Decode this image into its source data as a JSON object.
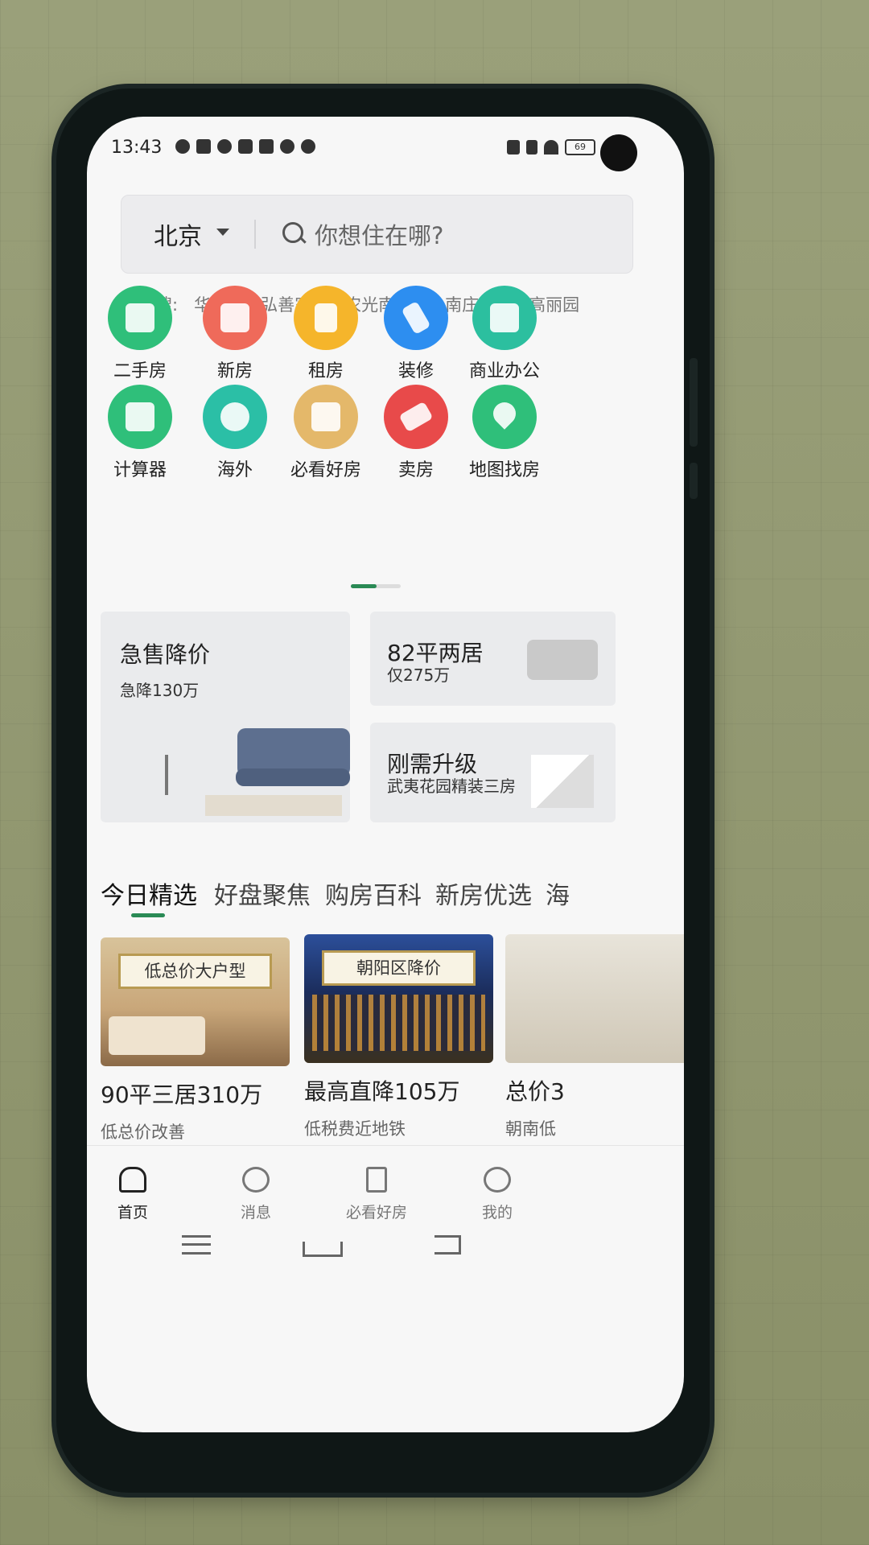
{
  "status_bar": {
    "time": "13:43",
    "battery": "69"
  },
  "search": {
    "city": "北京",
    "placeholder": "你想住在哪?"
  },
  "hot_search": {
    "label": "热搜:",
    "items": [
      "华贸城",
      "弘善家园",
      "农光南里",
      "小南庄社区",
      "高丽园"
    ]
  },
  "categories": {
    "row1": [
      {
        "label": "二手房",
        "color": "#2fbf7a",
        "icon": "house-icon"
      },
      {
        "label": "新房",
        "color": "#ef6a5a",
        "icon": "building-icon"
      },
      {
        "label": "租房",
        "color": "#f5b52b",
        "icon": "door-icon"
      },
      {
        "label": "装修",
        "color": "#2d8ef0",
        "icon": "paintbrush-icon"
      },
      {
        "label": "商业办公",
        "color": "#2cbf9f",
        "icon": "shop-icon"
      }
    ],
    "row2": [
      {
        "label": "计算器",
        "color": "#2fbf7a",
        "icon": "calculator-icon"
      },
      {
        "label": "海外",
        "color": "#2bbfa6",
        "icon": "globe-icon"
      },
      {
        "label": "必看好房",
        "color": "#e4b86a",
        "icon": "heart-house-icon"
      },
      {
        "label": "卖房",
        "color": "#e84a4a",
        "icon": "sale-tag-icon"
      },
      {
        "label": "地图找房",
        "color": "#2fbf7a",
        "icon": "map-pin-icon"
      }
    ]
  },
  "promos": {
    "main": {
      "title": "急售降价",
      "sub": "急降130万"
    },
    "top_right": {
      "title": "82平两居",
      "sub": "仅275万"
    },
    "bottom_right": {
      "title": "刚需升级",
      "sub": "武夷花园精装三房"
    }
  },
  "tabs": [
    "今日精选",
    "好盘聚焦",
    "购房百科",
    "新房优选",
    "海"
  ],
  "feed": [
    {
      "ribbon": "低总价大户型",
      "title": "90平三居310万",
      "sub": "低总价改善"
    },
    {
      "ribbon": "朝阳区降价",
      "title": "最高直降105万",
      "sub": "低税费近地铁"
    },
    {
      "ribbon": "",
      "title": "总价3",
      "sub": "朝南低"
    }
  ],
  "bottom_nav": [
    "首页",
    "消息",
    "必看好房",
    "我的"
  ],
  "colors": {
    "accent": "#2a8a55"
  }
}
